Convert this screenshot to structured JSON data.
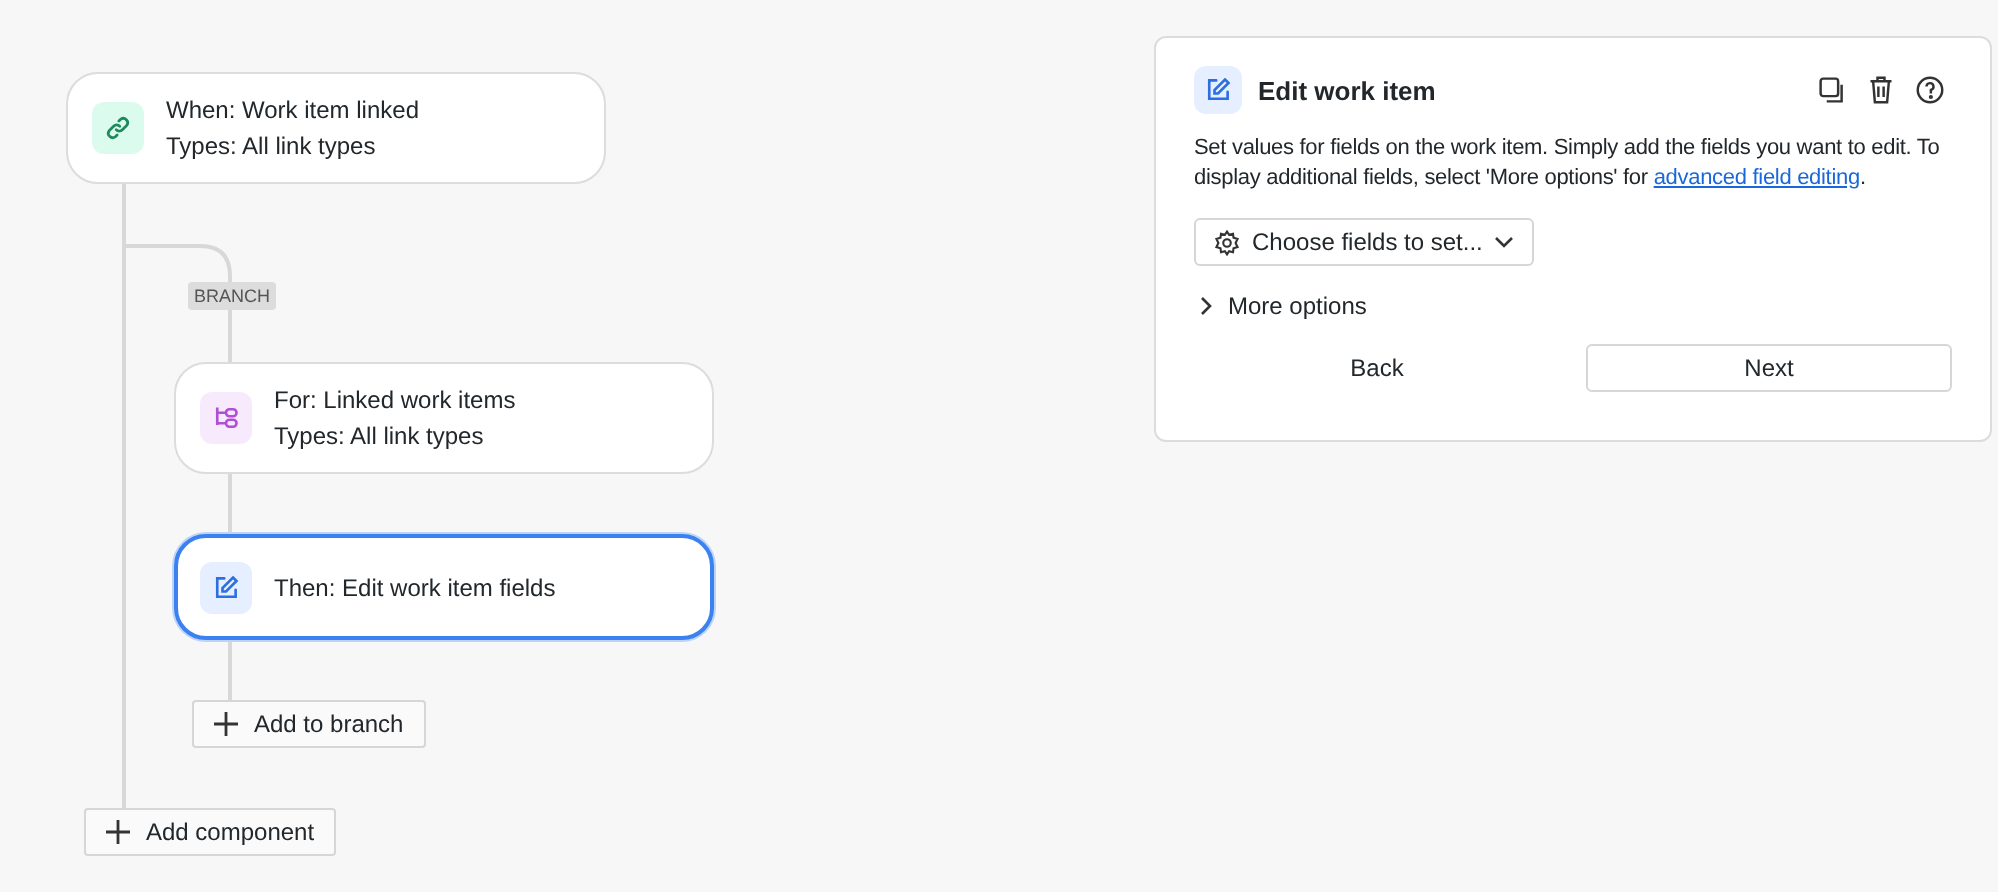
{
  "canvas": {
    "nodes": [
      {
        "kind": "trigger",
        "lines": [
          "When: Work item linked",
          "Types: All link types"
        ],
        "selected": false
      },
      {
        "kind": "branch",
        "lines": [
          "For: Linked work items",
          "Types: All link types"
        ],
        "selected": false
      },
      {
        "kind": "action",
        "lines": [
          "Then: Edit work item fields"
        ],
        "selected": true
      }
    ],
    "branch_label": "BRANCH",
    "add_to_branch": "Add to branch",
    "add_component": "Add component"
  },
  "panel": {
    "title": "Edit work item",
    "description": "Set values for fields on the work item. Simply add the fields you want to edit. To display additional fields, select 'More options' for ",
    "link": "advanced field editing",
    "description_end": ".",
    "fields_dropdown": "Choose fields to set...",
    "more_options": {
      "label": "More options",
      "expanded": false
    },
    "buttons": [
      {
        "label": "Back",
        "kind": "plain"
      },
      {
        "label": "Next",
        "kind": "outlined"
      }
    ]
  }
}
